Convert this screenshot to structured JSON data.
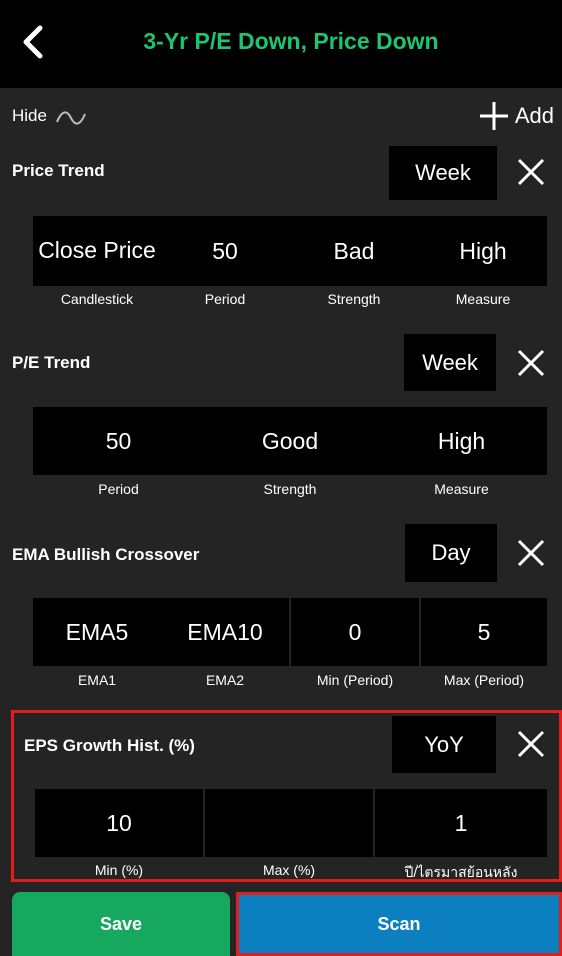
{
  "header": {
    "title": "3-Yr P/E Down, Price Down"
  },
  "toolbar": {
    "hide_label": "Hide",
    "add_label": "Add"
  },
  "sections": [
    {
      "title": "Price Trend",
      "unit": "Week",
      "fields": [
        {
          "value": "Close Price",
          "caption": "Candlestick"
        },
        {
          "value": "50",
          "caption": "Period"
        },
        {
          "value": "Bad",
          "caption": "Strength"
        },
        {
          "value": "High",
          "caption": "Measure"
        }
      ]
    },
    {
      "title": "P/E Trend",
      "unit": "Week",
      "fields": [
        {
          "value": "50",
          "caption": "Period"
        },
        {
          "value": "Good",
          "caption": "Strength"
        },
        {
          "value": "High",
          "caption": "Measure"
        }
      ]
    },
    {
      "title": "EMA Bullish Crossover",
      "unit": "Day",
      "fields": [
        {
          "value": "EMA5",
          "caption": "EMA1"
        },
        {
          "value": "EMA10",
          "caption": "EMA2"
        },
        {
          "value": "0",
          "caption": "Min (Period)"
        },
        {
          "value": "5",
          "caption": "Max (Period)"
        }
      ]
    },
    {
      "title": "EPS Growth Hist. (%)",
      "unit": "YoY",
      "fields": [
        {
          "value": "10",
          "caption": "Min (%)"
        },
        {
          "value": "",
          "caption": "Max (%)"
        },
        {
          "value": "1",
          "caption": "ปี/ไตรมาสย้อนหลัง"
        }
      ]
    }
  ],
  "actions": {
    "save_label": "Save",
    "scan_label": "Scan"
  },
  "colors": {
    "title_green": "#1fc46e",
    "save_green": "#15a85e",
    "scan_blue": "#0b7fc0",
    "highlight_red": "#e01e1e"
  }
}
